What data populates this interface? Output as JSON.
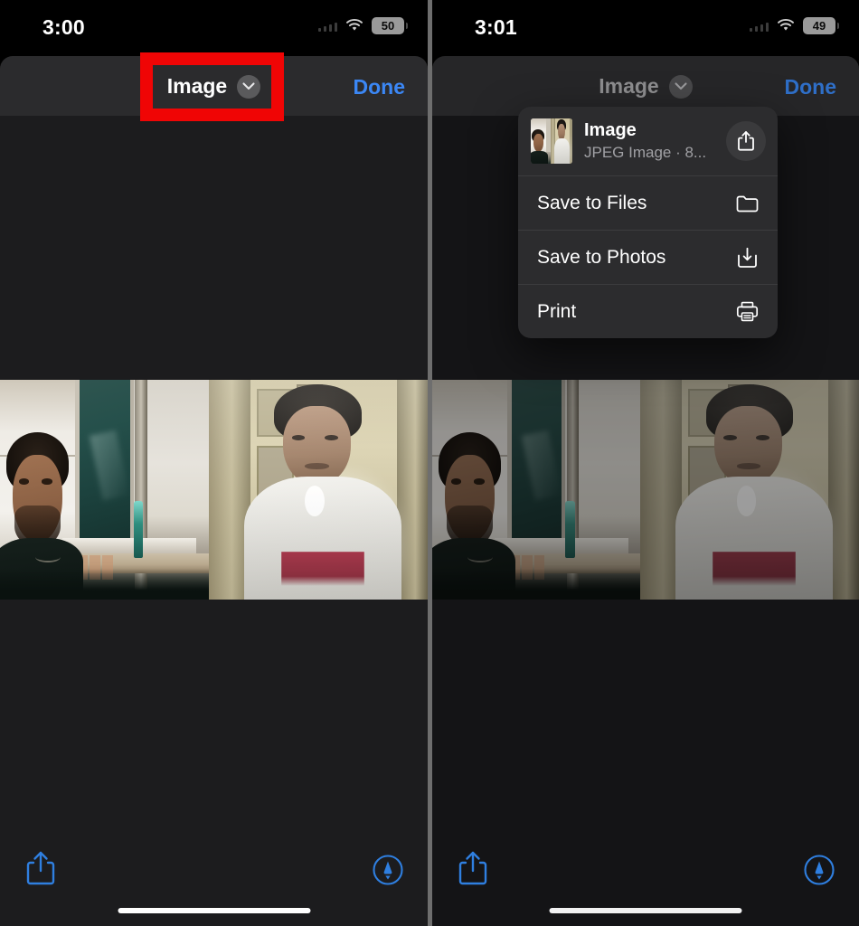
{
  "meta": {
    "accent_blue": "#3b87f5",
    "annotation_red": "#f00505",
    "menu_bg": "#2c2c2e",
    "navbar_bg": "#2b2b2d",
    "content_bg": "#1c1c1e"
  },
  "panels": [
    {
      "id": "left",
      "statusbar": {
        "time": "3:00",
        "battery": "50",
        "wifi_icon": "wifi-icon",
        "signal_icon": "cellular-signal-icon"
      },
      "navbar": {
        "title": "Image",
        "chevron_icon": "chevron-down-icon",
        "done_label": "Done"
      },
      "toolbar": {
        "share_icon": "share-icon",
        "markup_icon": "markup-pen-icon",
        "home_indicator": "home-indicator"
      },
      "photo": {
        "alt": "video-call-screenshot"
      }
    },
    {
      "id": "right",
      "statusbar": {
        "time": "3:01",
        "battery": "49",
        "wifi_icon": "wifi-icon",
        "signal_icon": "cellular-signal-icon"
      },
      "navbar": {
        "title": "Image",
        "chevron_icon": "chevron-down-icon",
        "done_label": "Done"
      },
      "toolbar": {
        "share_icon": "share-icon",
        "markup_icon": "markup-pen-icon",
        "home_indicator": "home-indicator"
      },
      "photo": {
        "alt": "video-call-screenshot"
      },
      "menu": {
        "header": {
          "title": "Image",
          "subtitle": "JPEG Image · 8...",
          "thumbnail": "image-thumbnail",
          "share_icon": "share-icon"
        },
        "items": [
          {
            "label": "Save to Files",
            "icon": "folder-icon",
            "highlighted": false
          },
          {
            "label": "Save to Photos",
            "icon": "download-icon",
            "highlighted": true
          },
          {
            "label": "Print",
            "icon": "printer-icon",
            "highlighted": false
          }
        ]
      }
    }
  ],
  "annotations": [
    {
      "id": "redbox-left",
      "target": "navbar-title-image"
    },
    {
      "id": "redbox-right",
      "target": "menu-item-save-to-photos"
    }
  ]
}
